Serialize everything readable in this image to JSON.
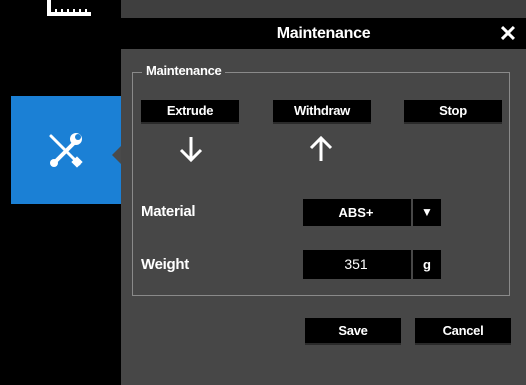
{
  "sidebar": {
    "ruler_icon": "ruler-icon",
    "tool_icon": "wrench-screwdriver-icon",
    "active_color": "#1b80d5"
  },
  "dialog": {
    "title": "Maintenance",
    "close_icon": "close-icon",
    "group_label": "Maintenance",
    "buttons": {
      "extrude": "Extrude",
      "withdraw": "Withdraw",
      "stop": "Stop"
    },
    "arrows": {
      "extrude": "arrow-down-icon",
      "withdraw": "arrow-up-icon"
    },
    "material": {
      "label": "Material",
      "value": "ABS+",
      "caret": "▼"
    },
    "weight": {
      "label": "Weight",
      "value": "351",
      "unit": "g"
    },
    "save_label": "Save",
    "cancel_label": "Cancel"
  }
}
